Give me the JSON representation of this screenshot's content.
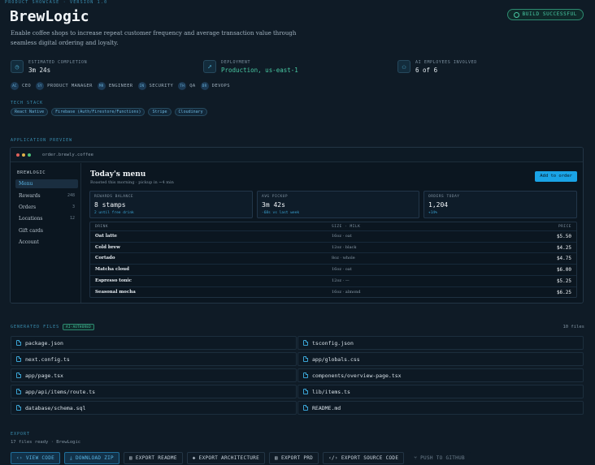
{
  "header": {
    "eyebrow": "PRODUCT SHOWCASE · VERSION 1.0",
    "title": "BrewLogic",
    "description": "Enable coffee shops to increase repeat customer frequency and average transaction value through seamless digital ordering and loyalty.",
    "status": "BUILD SUCCESSFUL"
  },
  "stats": [
    {
      "label": "ESTIMATED COMPLETION",
      "value": "3m 24s",
      "icon": "clock-icon"
    },
    {
      "label": "DEPLOYMENT",
      "value": "Production, us-east-1",
      "icon": "rocket-icon"
    },
    {
      "label": "AI EMPLOYEES INVOLVED",
      "value": "6 of 6",
      "icon": "users-icon"
    }
  ],
  "roles": [
    {
      "initials": "AC",
      "label": "CEO"
    },
    {
      "initials": "SY",
      "label": "PRODUCT MANAGER"
    },
    {
      "initials": "MR",
      "label": "ENGINEER"
    },
    {
      "initials": "IN",
      "label": "SECURITY"
    },
    {
      "initials": "TH",
      "label": "QA"
    },
    {
      "initials": "DR",
      "label": "DEVOPS"
    }
  ],
  "tech_stack": {
    "label": "TECH STACK",
    "items": [
      "React Native",
      "Firebase (Auth/Firestore/Functions)",
      "Stripe",
      "Cloudinary"
    ]
  },
  "preview": {
    "label": "APPLICATION PREVIEW",
    "url": "order.brewly.coffee",
    "brand": "BREWLOGIC",
    "nav": [
      {
        "label": "Menu",
        "count": ""
      },
      {
        "label": "Rewards",
        "count": "248"
      },
      {
        "label": "Orders",
        "count": "3"
      },
      {
        "label": "Locations",
        "count": "12"
      },
      {
        "label": "Gift cards",
        "count": ""
      },
      {
        "label": "Account",
        "count": ""
      }
    ],
    "title": "Today's menu",
    "subtitle": "Roasted this morning · pickup in ~4 min",
    "add_button": "Add to order",
    "cards": [
      {
        "label": "REWARDS BALANCE",
        "value": "8 stamps",
        "hint": "2 until free drink"
      },
      {
        "label": "AVG PICKUP",
        "value": "3m 42s",
        "hint": "-68s vs last week"
      },
      {
        "label": "ORDERS TODAY",
        "value": "1,204",
        "hint": "+14%"
      }
    ],
    "table": {
      "headers": [
        "DRINK",
        "SIZE · MILK",
        "PRICE"
      ],
      "rows": [
        [
          "Oat latte",
          "16oz · oat",
          "$5.50"
        ],
        [
          "Cold brew",
          "12oz · black",
          "$4.25"
        ],
        [
          "Cortado",
          "8oz · whole",
          "$4.75"
        ],
        [
          "Matcha cloud",
          "16oz · oat",
          "$6.00"
        ],
        [
          "Espresso tonic",
          "12oz · —",
          "$5.25"
        ],
        [
          "Seasonal mocha",
          "16oz · almond",
          "$6.25"
        ]
      ]
    }
  },
  "files": {
    "label": "GENERATED FILES",
    "badge": "AI-AUTHORED",
    "count": "10 files",
    "items": [
      "package.json",
      "tsconfig.json",
      "next.config.ts",
      "app/globals.css",
      "app/page.tsx",
      "components/overview-page.tsx",
      "app/api/items/route.ts",
      "lib/items.ts",
      "database/schema.sql",
      "README.md"
    ]
  },
  "export": {
    "label": "EXPORT",
    "sub": "17 files ready · BrewLogic",
    "buttons": [
      {
        "label": "VIEW CODE",
        "icon": "code-icon"
      },
      {
        "label": "DOWNLOAD ZIP",
        "icon": "download-icon"
      },
      {
        "label": "EXPORT README",
        "icon": "file-icon"
      },
      {
        "label": "EXPORT ARCHITECTURE",
        "icon": "layers-icon"
      },
      {
        "label": "EXPORT PRD",
        "icon": "file-icon"
      },
      {
        "label": "EXPORT SOURCE CODE",
        "icon": "code-icon"
      },
      {
        "label": "PUSH TO GITHUB",
        "icon": "git-branch-icon"
      }
    ]
  },
  "colors": {
    "accent": "#1aa3e6",
    "success": "#48c9a3",
    "background": "#0f1b26"
  }
}
